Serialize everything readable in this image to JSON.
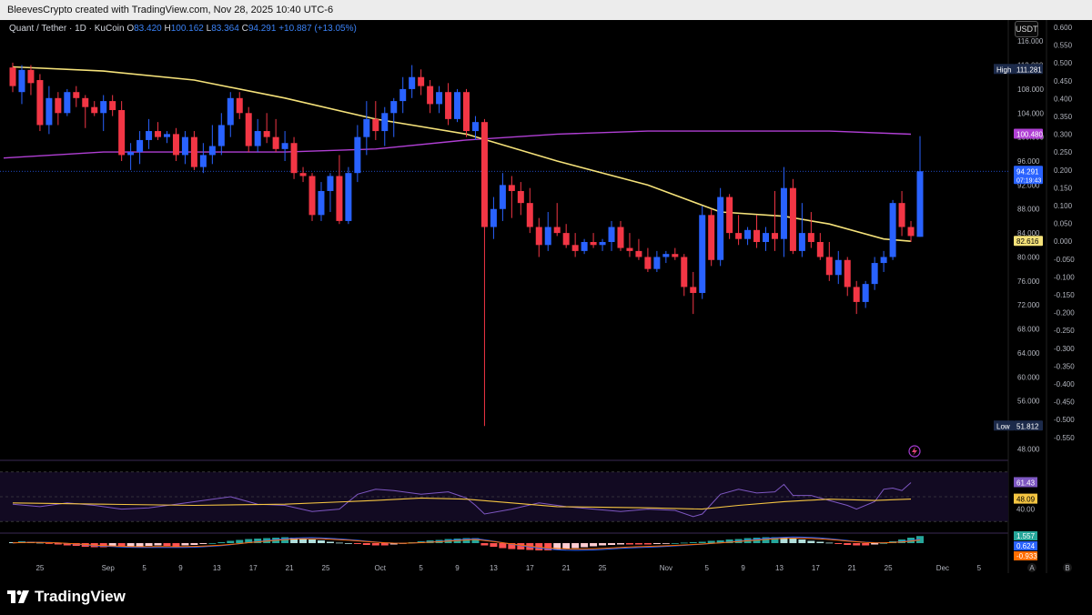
{
  "header": {
    "attribution": "BleevesCrypto created with TradingView.com, Nov 28, 2025 10:40 UTC-6"
  },
  "legend": {
    "symbol": "Quant / Tether · 1D · KuCoin",
    "o_label": "O",
    "o_value": "83.420",
    "h_label": "H",
    "h_value": "100.162",
    "l_label": "L",
    "l_value": "83.364",
    "c_label": "C",
    "c_value": "94.291",
    "change": "+10.887 (+13.05%)"
  },
  "currency_button": "USDT",
  "colors": {
    "up": "#2962ff",
    "down": "#f23645",
    "ma_yellow": "#f5e27a",
    "ma_purple": "#b03fd4",
    "rsi": "#7e57c2",
    "rsi_ma": "#f5c542",
    "bg": "#000000"
  },
  "footer": {
    "brand": "TradingView",
    "scale_a": "A",
    "scale_b": "B"
  },
  "chart_data": {
    "type": "candlestick",
    "price_axis": {
      "ticks": [
        "116.000",
        "112.000",
        "108.000",
        "104.000",
        "100.000",
        "96.000",
        "92.000",
        "88.000",
        "84.000",
        "80.000",
        "76.000",
        "72.000",
        "68.000",
        "64.000",
        "60.000",
        "56.000",
        "52.000",
        "48.000"
      ],
      "range": [
        47,
        118
      ]
    },
    "secondary_axis": {
      "ticks": [
        "0.600",
        "0.550",
        "0.500",
        "0.450",
        "0.400",
        "0.350",
        "0.300",
        "0.250",
        "0.200",
        "0.150",
        "0.100",
        "0.050",
        "0.000",
        "-0.050",
        "-0.100",
        "-0.150",
        "-0.200",
        "-0.250",
        "-0.300",
        "-0.350",
        "-0.400",
        "-0.450",
        "-0.500",
        "-0.550"
      ]
    },
    "price_labels": [
      {
        "text": "High",
        "value": "111.281",
        "price": 111.281,
        "kind": "high"
      },
      {
        "text": "",
        "value": "100.480",
        "price": 100.48,
        "kind": "ma_purple"
      },
      {
        "text": "",
        "value": "94.291",
        "sub": "07:19:43",
        "price": 94.291,
        "kind": "last"
      },
      {
        "text": "",
        "value": "82.616",
        "price": 82.616,
        "kind": "ma_yellow"
      },
      {
        "text": "Low",
        "value": "51.812",
        "price": 51.812,
        "kind": "low"
      }
    ],
    "x_labels": [
      "25",
      "Sep",
      "5",
      "9",
      "13",
      "17",
      "21",
      "25",
      "Oct",
      "5",
      "9",
      "13",
      "17",
      "21",
      "25",
      "Nov",
      "5",
      "9",
      "13",
      "17",
      "21",
      "25",
      "Dec",
      "5"
    ],
    "candles": [
      [
        111.6,
        112.4,
        107.5,
        108.5
      ],
      [
        107.5,
        112,
        105.5,
        111.2
      ],
      [
        111.2,
        112,
        107,
        109
      ],
      [
        109.5,
        110.5,
        101,
        102
      ],
      [
        102,
        108.5,
        100.5,
        106.5
      ],
      [
        106.5,
        107.5,
        102,
        104
      ],
      [
        104,
        108,
        103.5,
        107.5
      ],
      [
        107.5,
        108.5,
        105,
        106.5
      ],
      [
        106.5,
        107,
        101.5,
        105
      ],
      [
        105,
        106,
        103.5,
        104
      ],
      [
        104,
        107,
        101,
        106
      ],
      [
        106,
        107,
        103.5,
        104.5
      ],
      [
        104.5,
        106,
        96,
        97
      ],
      [
        97,
        99,
        94.5,
        97.5
      ],
      [
        97.5,
        101,
        95.5,
        99.5
      ],
      [
        99.5,
        103,
        98,
        101
      ],
      [
        101,
        102.5,
        99.5,
        100
      ],
      [
        100,
        101,
        99,
        100.5
      ],
      [
        100.5,
        101.5,
        96,
        97
      ],
      [
        97,
        101,
        95.5,
        100
      ],
      [
        100,
        101,
        94.5,
        95
      ],
      [
        95,
        99,
        94,
        97
      ],
      [
        97,
        102,
        95.5,
        98.5
      ],
      [
        98.5,
        104,
        97,
        102
      ],
      [
        102,
        107.5,
        100,
        106.5
      ],
      [
        106.5,
        107.5,
        103,
        104
      ],
      [
        104,
        105,
        97.5,
        98.5
      ],
      [
        98.5,
        103,
        97.5,
        101
      ],
      [
        101,
        104,
        99,
        100
      ],
      [
        100,
        103,
        97.5,
        98
      ],
      [
        98,
        101,
        96,
        99
      ],
      [
        99,
        100,
        93,
        94
      ],
      [
        94,
        95,
        92.5,
        93.5
      ],
      [
        93.5,
        94,
        86,
        87
      ],
      [
        87,
        92.5,
        86,
        91
      ],
      [
        91,
        94,
        87.5,
        93.5
      ],
      [
        93.5,
        97,
        85.5,
        86
      ],
      [
        86,
        95,
        85.5,
        94
      ],
      [
        94,
        102,
        92.5,
        100
      ],
      [
        100,
        106,
        97,
        103
      ],
      [
        103,
        106,
        99.5,
        101
      ],
      [
        101,
        105,
        98.5,
        104
      ],
      [
        104,
        106.5,
        100,
        106
      ],
      [
        106,
        110,
        104,
        108
      ],
      [
        108,
        112,
        106.5,
        110
      ],
      [
        110,
        111.281,
        107,
        108.5
      ],
      [
        108.5,
        109.5,
        104,
        105.5
      ],
      [
        105.5,
        108.5,
        104,
        107.5
      ],
      [
        107.5,
        109,
        102,
        103
      ],
      [
        103,
        108,
        102.5,
        107.5
      ],
      [
        107.5,
        108,
        100,
        101
      ],
      [
        101,
        103.5,
        99.5,
        102.5
      ],
      [
        102.5,
        103,
        51.812,
        85
      ],
      [
        85,
        90,
        83,
        88
      ],
      [
        88,
        94,
        86,
        92
      ],
      [
        92,
        93.5,
        86.5,
        91
      ],
      [
        91,
        92.5,
        87,
        89
      ],
      [
        89,
        91.5,
        84,
        85
      ],
      [
        85,
        86.5,
        80,
        82
      ],
      [
        82,
        87.5,
        81,
        85
      ],
      [
        85,
        89,
        83.5,
        84
      ],
      [
        84,
        85.5,
        81.5,
        82
      ],
      [
        82,
        84,
        80,
        81
      ],
      [
        81,
        83,
        80.5,
        82.5
      ],
      [
        82.5,
        84,
        81.5,
        82
      ],
      [
        82,
        83,
        81,
        82.5
      ],
      [
        82.5,
        86,
        81,
        85
      ],
      [
        85,
        86,
        81,
        81.5
      ],
      [
        81.5,
        84,
        80,
        81
      ],
      [
        81,
        83,
        79.5,
        80
      ],
      [
        80,
        81.5,
        77.5,
        78
      ],
      [
        78,
        81,
        77.5,
        80
      ],
      [
        80,
        81,
        79,
        80.5
      ],
      [
        80.5,
        81.5,
        79.5,
        80
      ],
      [
        80,
        80.5,
        73.5,
        75
      ],
      [
        75,
        77.5,
        70.5,
        74
      ],
      [
        74,
        88.5,
        73,
        87
      ],
      [
        87,
        88,
        78.5,
        79.5
      ],
      [
        79.5,
        91.5,
        78.5,
        90
      ],
      [
        90,
        90.5,
        83,
        84
      ],
      [
        84,
        87,
        82,
        83
      ],
      [
        83,
        85,
        82,
        84.5
      ],
      [
        84.5,
        87,
        81.5,
        82.5
      ],
      [
        82.5,
        85,
        81,
        84
      ],
      [
        84,
        91,
        81,
        83
      ],
      [
        83,
        95,
        80,
        91.5
      ],
      [
        91.5,
        93,
        80.5,
        81
      ],
      [
        81,
        89,
        80,
        84
      ],
      [
        84,
        87.5,
        81.5,
        82.5
      ],
      [
        82.5,
        84,
        79.5,
        80
      ],
      [
        80,
        82.5,
        76,
        77
      ],
      [
        77,
        81,
        75.5,
        79.5
      ],
      [
        79.5,
        80,
        73.5,
        75
      ],
      [
        75,
        76,
        70.5,
        72.5
      ],
      [
        72.5,
        76,
        71.5,
        75.5
      ],
      [
        75.5,
        80,
        74.5,
        79
      ],
      [
        79,
        81,
        77.5,
        80
      ],
      [
        80,
        89.5,
        79.5,
        89
      ],
      [
        89,
        91,
        83.5,
        85
      ],
      [
        85,
        86,
        82.5,
        83.5
      ],
      [
        83.364,
        100.162,
        83.364,
        94.291
      ]
    ],
    "ma_yellow": [
      [
        0,
        111.7
      ],
      [
        10,
        111
      ],
      [
        20,
        109.5
      ],
      [
        30,
        106.5
      ],
      [
        40,
        103
      ],
      [
        50,
        100.5
      ],
      [
        60,
        96
      ],
      [
        70,
        92
      ],
      [
        78,
        87.5
      ],
      [
        85,
        86.8
      ],
      [
        90,
        85.5
      ],
      [
        96,
        83
      ],
      [
        99,
        82.616
      ]
    ],
    "ma_purple": [
      [
        -1,
        96.5
      ],
      [
        10,
        97.5
      ],
      [
        20,
        97.5
      ],
      [
        30,
        97.5
      ],
      [
        40,
        98
      ],
      [
        50,
        99.5
      ],
      [
        60,
        100.5
      ],
      [
        70,
        101
      ],
      [
        80,
        101
      ],
      [
        90,
        101
      ],
      [
        99,
        100.48
      ]
    ],
    "rsi": {
      "labels": [
        "61.43",
        "48.09",
        "40.00"
      ],
      "rsi_line": [
        [
          0,
          44
        ],
        [
          3,
          42
        ],
        [
          6,
          45
        ],
        [
          9,
          43
        ],
        [
          12,
          40
        ],
        [
          15,
          41
        ],
        [
          18,
          44
        ],
        [
          21,
          47
        ],
        [
          24,
          50
        ],
        [
          27,
          44
        ],
        [
          30,
          43
        ],
        [
          33,
          38
        ],
        [
          36,
          40
        ],
        [
          38,
          52
        ],
        [
          40,
          56
        ],
        [
          42,
          55
        ],
        [
          45,
          52
        ],
        [
          48,
          54
        ],
        [
          50,
          49
        ],
        [
          51,
          43
        ],
        [
          52,
          36
        ],
        [
          55,
          40
        ],
        [
          58,
          45
        ],
        [
          61,
          42
        ],
        [
          64,
          40
        ],
        [
          67,
          38
        ],
        [
          70,
          40
        ],
        [
          73,
          39
        ],
        [
          75,
          34
        ],
        [
          76,
          36
        ],
        [
          78,
          52
        ],
        [
          80,
          56
        ],
        [
          82,
          53
        ],
        [
          84,
          54
        ],
        [
          85,
          60
        ],
        [
          86,
          51
        ],
        [
          88,
          51
        ],
        [
          90,
          47
        ],
        [
          92,
          43
        ],
        [
          93,
          40
        ],
        [
          95,
          46
        ],
        [
          96,
          56
        ],
        [
          97,
          57
        ],
        [
          98,
          55
        ],
        [
          99,
          61.43
        ]
      ],
      "ma_line": [
        [
          0,
          45
        ],
        [
          10,
          44
        ],
        [
          20,
          43
        ],
        [
          30,
          44
        ],
        [
          40,
          47
        ],
        [
          45,
          49
        ],
        [
          50,
          48
        ],
        [
          60,
          42
        ],
        [
          70,
          41
        ],
        [
          76,
          40
        ],
        [
          80,
          43
        ],
        [
          85,
          46
        ],
        [
          90,
          48
        ],
        [
          95,
          47
        ],
        [
          99,
          48.09
        ]
      ]
    },
    "macd": {
      "labels": [
        "1.557",
        "0.624",
        "-0.933"
      ],
      "hist": [
        0.2,
        0.4,
        0.3,
        0.1,
        -0.1,
        -0.3,
        -0.5,
        -0.6,
        -0.8,
        -0.9,
        -0.9,
        -0.8,
        -0.9,
        -0.8,
        -0.7,
        -0.6,
        -0.5,
        -0.6,
        -0.7,
        -0.5,
        -0.4,
        -0.2,
        0,
        0.2,
        0.5,
        0.7,
        0.9,
        1,
        1.1,
        1.2,
        1.3,
        1.2,
        1,
        0.8,
        0.6,
        0.3,
        0.1,
        0,
        -0.2,
        -0.4,
        -0.5,
        -0.5,
        -0.3,
        -0.1,
        0.2,
        0.4,
        0.6,
        0.7,
        0.9,
        1,
        1.1,
        1.1,
        -0.5,
        -0.8,
        -1.1,
        -1.3,
        -1.4,
        -1.5,
        -1.6,
        -1.6,
        -1.5,
        -1.3,
        -1.1,
        -0.9,
        -0.7,
        -0.5,
        -0.4,
        -0.3,
        -0.3,
        -0.3,
        -0.3,
        -0.2,
        -0.1,
        0,
        0.1,
        0.2,
        0.3,
        0.5,
        0.6,
        0.8,
        0.9,
        1.1,
        1.2,
        1.3,
        1.3,
        1.2,
        1,
        0.8,
        0.5,
        0.3,
        0.1,
        -0.2,
        -0.4,
        -0.5,
        -0.5,
        -0.3,
        0,
        0.4,
        0.8,
        1.2,
        1.557
      ]
    }
  }
}
